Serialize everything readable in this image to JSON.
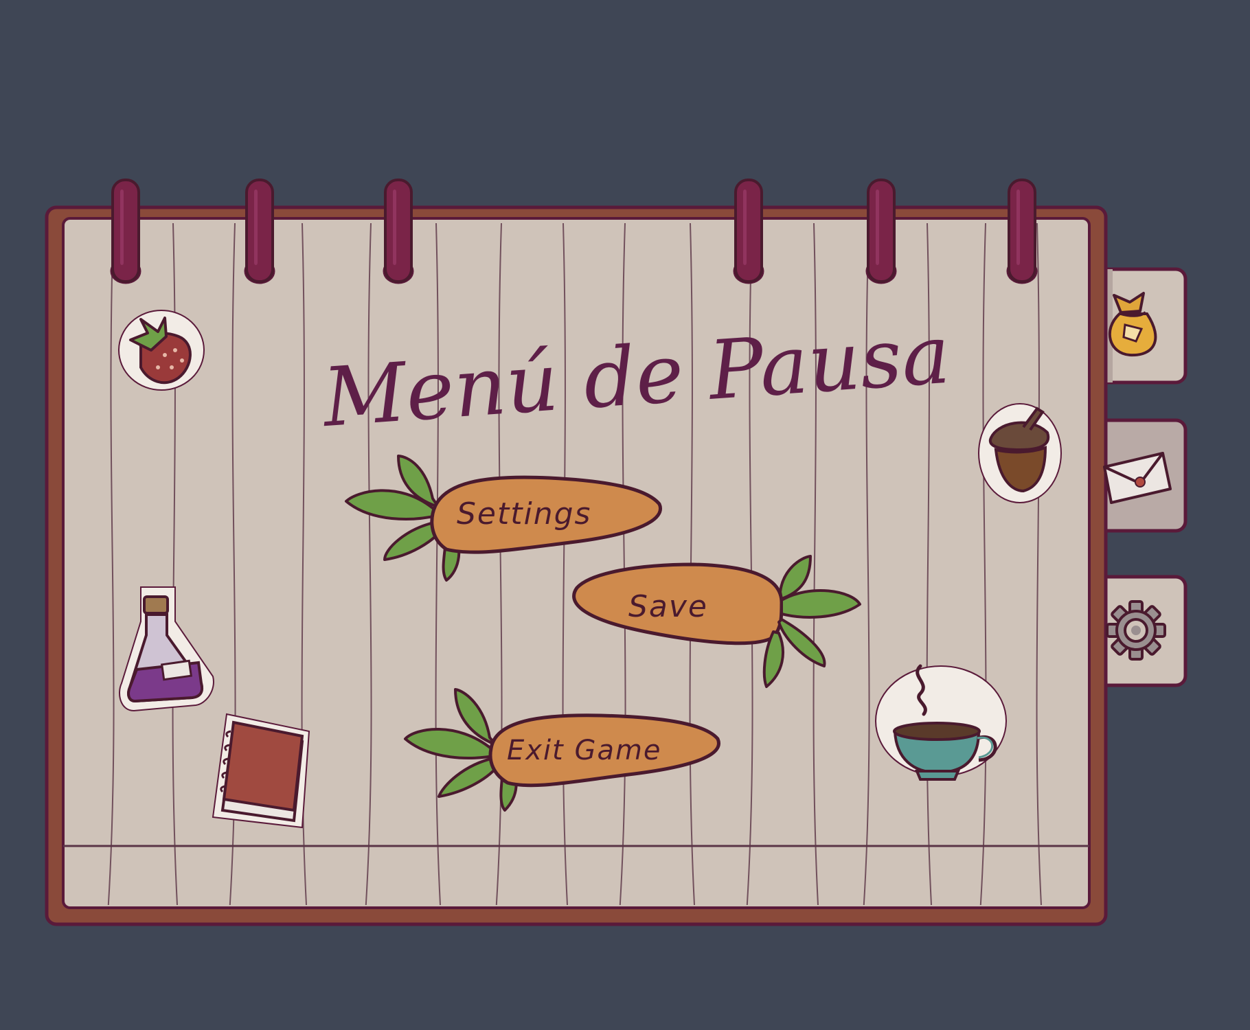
{
  "menu": {
    "title": "Menú de Pausa",
    "buttons": [
      {
        "id": "settings",
        "label": "Settings"
      },
      {
        "id": "save",
        "label": "Save"
      },
      {
        "id": "exit",
        "label": "Exit Game"
      }
    ]
  },
  "side_tabs": [
    {
      "id": "inventory",
      "icon": "pouch-icon"
    },
    {
      "id": "mail",
      "icon": "envelope-icon"
    },
    {
      "id": "settings",
      "icon": "gear-icon"
    }
  ],
  "colors": {
    "background": "#3f4655",
    "page": "#cfc3b9",
    "frame": "#8a4a3a",
    "outline": "#5a1a3a",
    "ring": "#7a2448",
    "carrot": "#cf8a4d",
    "leaf": "#6fa048",
    "title": "#5e1f48"
  }
}
